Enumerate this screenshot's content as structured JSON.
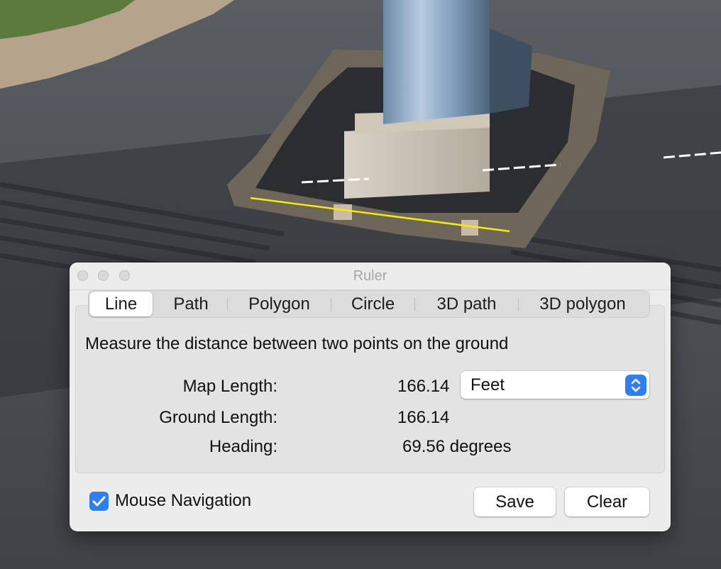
{
  "dialog": {
    "title": "Ruler"
  },
  "tabs": [
    {
      "label": "Line",
      "active": true
    },
    {
      "label": "Path",
      "active": false
    },
    {
      "label": "Polygon",
      "active": false
    },
    {
      "label": "Circle",
      "active": false
    },
    {
      "label": "3D path",
      "active": false
    },
    {
      "label": "3D polygon",
      "active": false
    }
  ],
  "description": "Measure the distance between two points on the ground",
  "measurements": {
    "map_length_label": "Map Length:",
    "map_length_value": "166.14",
    "ground_length_label": "Ground Length:",
    "ground_length_value": "166.14",
    "heading_label": "Heading:",
    "heading_value": "69.56 degrees"
  },
  "units_select": {
    "selected": "Feet"
  },
  "mouse_navigation": {
    "label": "Mouse Navigation",
    "checked": true
  },
  "buttons": {
    "save": "Save",
    "clear": "Clear"
  },
  "colors": {
    "accent": "#2f7ff0",
    "measure_line": "#f5ea10"
  }
}
